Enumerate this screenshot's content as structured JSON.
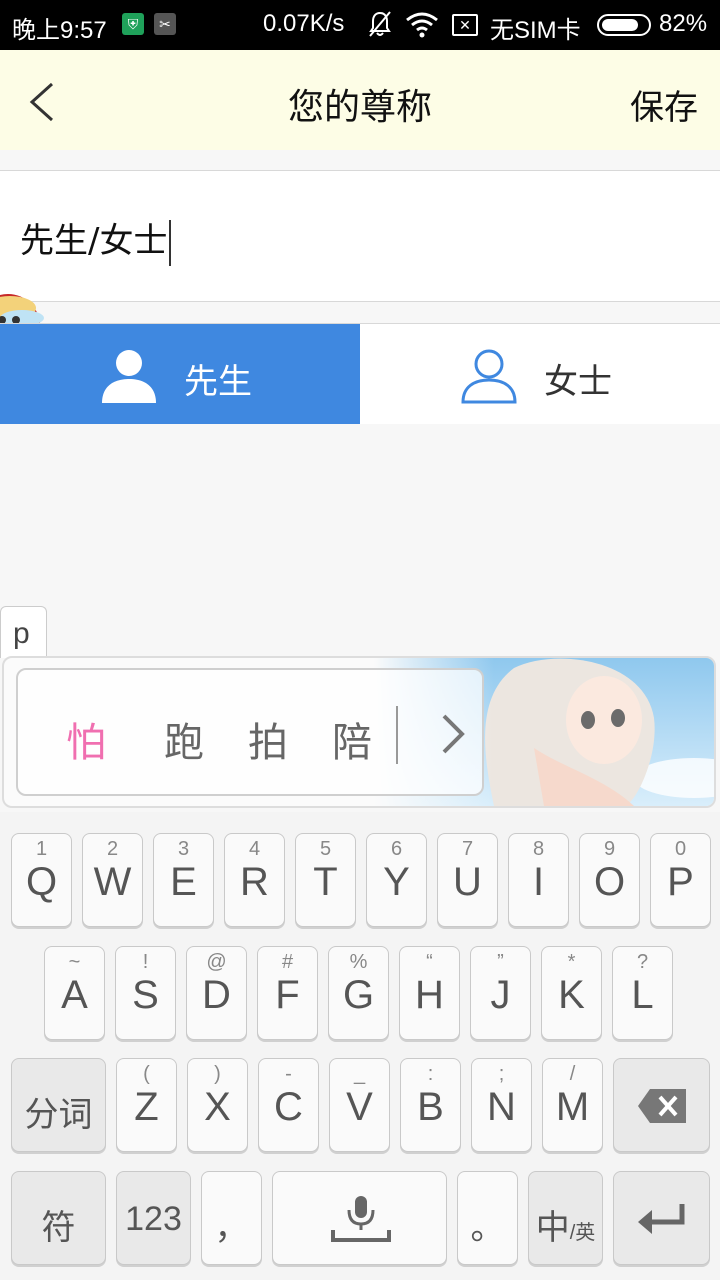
{
  "status_bar": {
    "time": "晚上9:57",
    "net_speed": "0.07K/s",
    "sim": "无SIM卡",
    "battery": "82%",
    "battery_level": 0.82
  },
  "header": {
    "title": "您的尊称",
    "save_label": "保存"
  },
  "name_field": {
    "value": "先生/女士"
  },
  "gender": {
    "male_label": "先生",
    "female_label": "女士",
    "selected": "male",
    "selected_color": "#3f88e0"
  },
  "keyboard": {
    "popup_char": "p",
    "candidates": [
      "怕",
      "跑",
      "拍",
      "陪"
    ],
    "highlight_color": "#f06fb0",
    "row1": [
      {
        "sup": "1",
        "key": "Q"
      },
      {
        "sup": "2",
        "key": "W"
      },
      {
        "sup": "3",
        "key": "E"
      },
      {
        "sup": "4",
        "key": "R"
      },
      {
        "sup": "5",
        "key": "T"
      },
      {
        "sup": "6",
        "key": "Y"
      },
      {
        "sup": "7",
        "key": "U"
      },
      {
        "sup": "8",
        "key": "I"
      },
      {
        "sup": "9",
        "key": "O"
      },
      {
        "sup": "0",
        "key": "P"
      }
    ],
    "row2": [
      {
        "sup": "~",
        "key": "A"
      },
      {
        "sup": "!",
        "key": "S"
      },
      {
        "sup": "@",
        "key": "D"
      },
      {
        "sup": "#",
        "key": "F"
      },
      {
        "sup": "%",
        "key": "G"
      },
      {
        "sup": "“",
        "key": "H"
      },
      {
        "sup": "”",
        "key": "J"
      },
      {
        "sup": "*",
        "key": "K"
      },
      {
        "sup": "?",
        "key": "L"
      }
    ],
    "row3": [
      {
        "sup": "(",
        "key": "Z"
      },
      {
        "sup": ")",
        "key": "X"
      },
      {
        "sup": "-",
        "key": "C"
      },
      {
        "sup": "_",
        "key": "V"
      },
      {
        "sup": ":",
        "key": "B"
      },
      {
        "sup": ";",
        "key": "N"
      },
      {
        "sup": "/",
        "key": "M"
      }
    ],
    "split_word_label": "分词",
    "symbols_label": "符",
    "numbers_label": "123",
    "comma_label": "，",
    "period_label": "。",
    "lang_main": "中",
    "lang_alt": "/英"
  }
}
